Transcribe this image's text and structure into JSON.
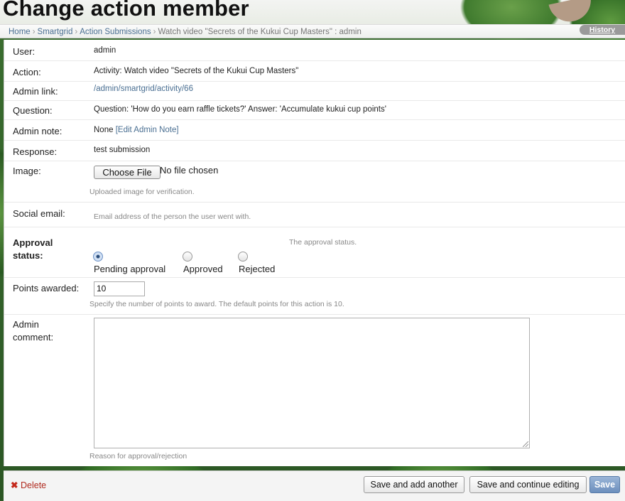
{
  "page": {
    "title": "Change action member"
  },
  "breadcrumbs": {
    "items": [
      "Home",
      "Smartgrid",
      "Action Submissions"
    ],
    "current": "Watch video \"Secrets of the Kukui Cup Masters\" : admin",
    "separator": "›"
  },
  "history_label": "History",
  "fields": {
    "user": {
      "label": "User:",
      "value": "admin"
    },
    "action": {
      "label": "Action:",
      "value": "Activity: Watch video \"Secrets of the Kukui Cup Masters\""
    },
    "admin_link": {
      "label": "Admin link:",
      "value": "/admin/smartgrid/activity/66"
    },
    "question": {
      "label": "Question:",
      "value": "Question: 'How do you earn raffle tickets?' Answer: 'Accumulate kukui cup points'"
    },
    "admin_note": {
      "label": "Admin note:",
      "value": "None",
      "link": "[Edit Admin Note]"
    },
    "response": {
      "label": "Response:",
      "value": "test submission"
    },
    "image": {
      "label": "Image:",
      "button": "Choose File",
      "status": "No file chosen",
      "help": "Uploaded image for verification."
    },
    "social_email": {
      "label": "Social email:",
      "help": "Email address of the person the user went with."
    },
    "approval_status": {
      "label_line1": "Approval",
      "label_line2": "status:",
      "help": "The approval status.",
      "options": [
        "Pending approval",
        "Approved",
        "Rejected"
      ],
      "selected": "Pending approval"
    },
    "points_awarded": {
      "label": "Points awarded:",
      "value": "10",
      "help": "Specify the number of points to award. The default points for this action is 10."
    },
    "admin_comment": {
      "label_line1": "Admin",
      "label_line2": "comment:",
      "value": "",
      "help": "Reason for approval/rejection"
    }
  },
  "footer": {
    "delete": "Delete",
    "save_add": "Save and add another",
    "save_continue": "Save and continue editing",
    "save": "Save"
  },
  "colors": {
    "link": "#4a6f92",
    "delete": "#b02a1e",
    "save_button": "#6c8fbd"
  }
}
